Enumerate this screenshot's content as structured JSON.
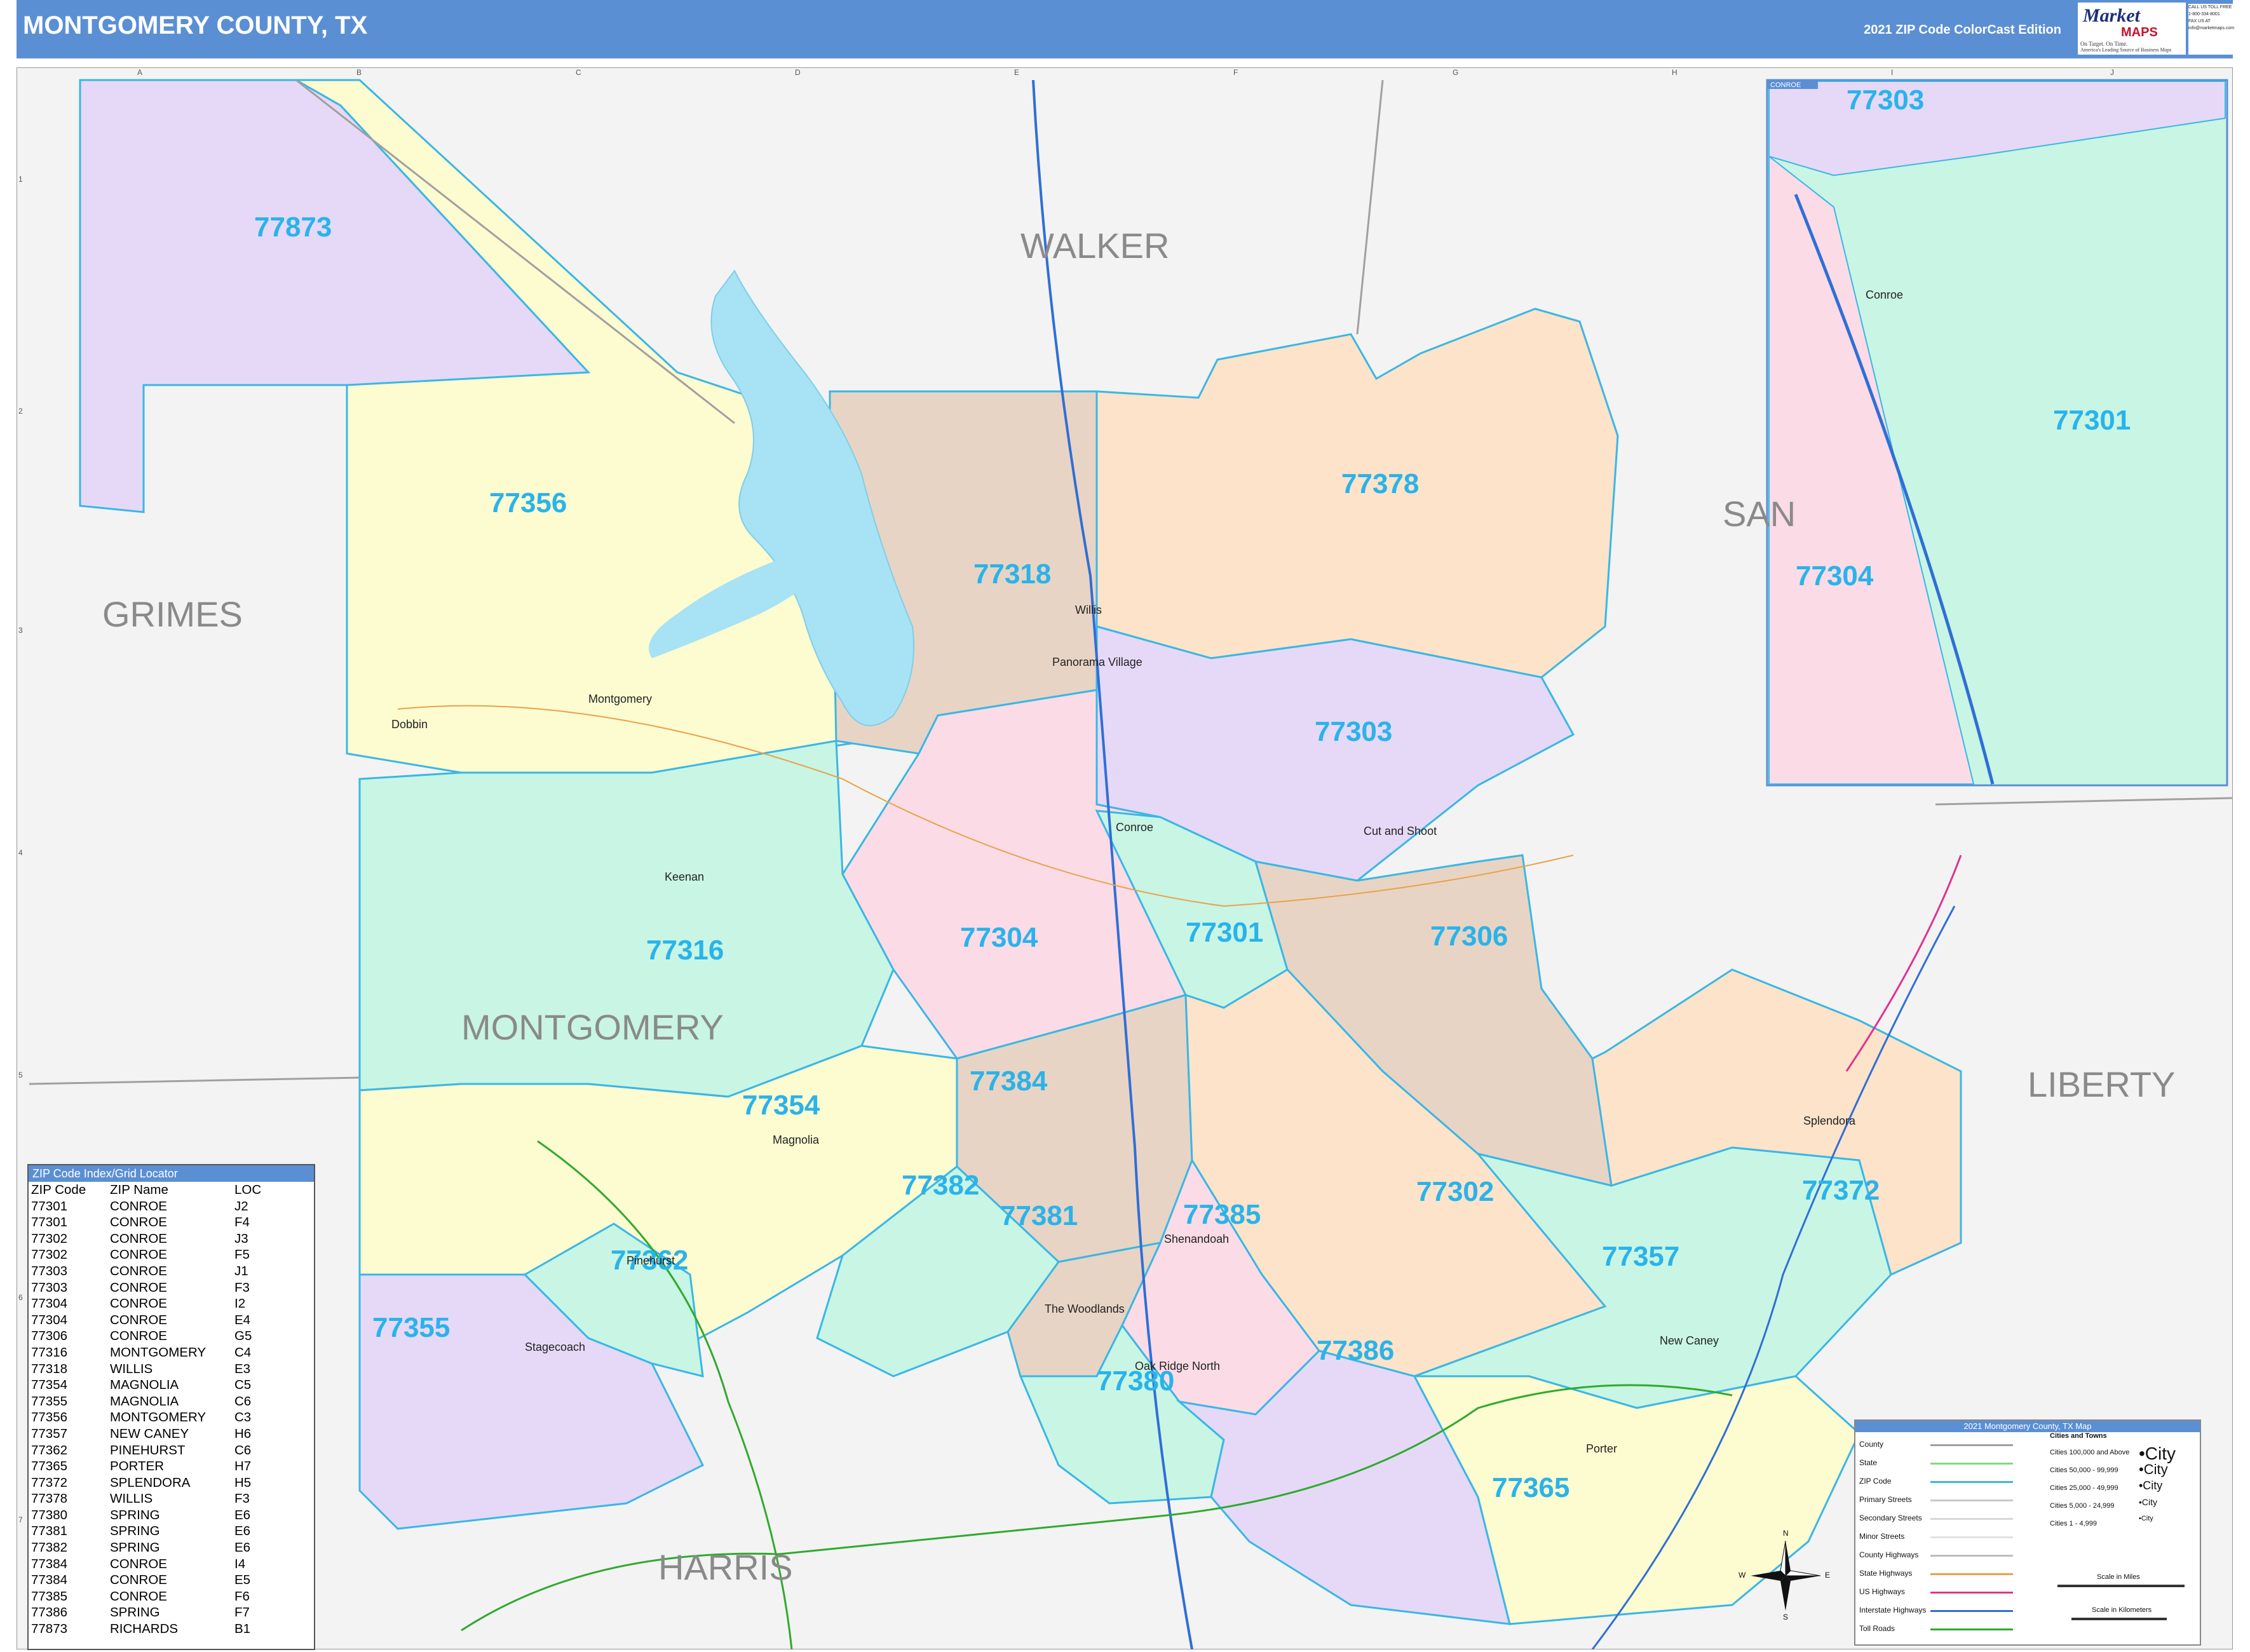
{
  "header": {
    "title": "MONTGOMERY COUNTY, TX",
    "edition": "2021 ZIP Code ColorCast Edition"
  },
  "logo": {
    "brand_top": "Market",
    "brand_bottom": "MAPS",
    "tagline1": "On Target. On Time.",
    "tagline2": "America's Leading Source of Business Maps",
    "side_lines": [
      "CALL US TOLL FREE",
      "1-800-334-8001",
      "FAX US AT",
      "info@marketmaps.com"
    ]
  },
  "counties": {
    "walker": "WALKER",
    "grimes": "GRIMES",
    "montgomery": "MONTGOMERY",
    "san_jacinto": "SAN",
    "liberty": "LIBERTY",
    "harris": "HARRIS"
  },
  "zip_labels": {
    "z77873": "77873",
    "z77356": "77356",
    "z77318": "77318",
    "z77378": "77378",
    "z77303": "77303",
    "z77316": "77316",
    "z77304": "77304",
    "z77301": "77301",
    "z77306": "77306",
    "z77384": "77384",
    "z77354": "77354",
    "z77382": "77382",
    "z77381": "77381",
    "z77385": "77385",
    "z77302": "77302",
    "z77372": "77372",
    "z77362": "77362",
    "z77357": "77357",
    "z77355": "77355",
    "z77386": "77386",
    "z77380": "77380",
    "z77365": "77365"
  },
  "inset": {
    "title": "CONROE",
    "city": "Conroe",
    "z77303": "77303",
    "z77301": "77301",
    "z77304": "77304"
  },
  "cities": {
    "woodlands": "The Woodlands",
    "montgomery": "Montgomery",
    "willis": "Willis",
    "conroe": "Conroe",
    "magnolia": "Magnolia",
    "splendora": "Splendora",
    "porter": "Porter",
    "new_caney": "New Caney",
    "shenandoah": "Shenandoah",
    "oak_ridge": "Oak Ridge North",
    "panorama": "Panorama Village",
    "cut_shoot": "Cut and Shoot",
    "pinehurst": "Pinehurst",
    "stagecoach": "Stagecoach",
    "keenan": "Keenan",
    "dobbin": "Dobbin"
  },
  "grid": {
    "columns": [
      "A",
      "B",
      "C",
      "D",
      "E",
      "F",
      "G",
      "H",
      "I",
      "J"
    ],
    "rows": [
      "1",
      "2",
      "3",
      "4",
      "5",
      "6",
      "7"
    ]
  },
  "index": {
    "title": "ZIP Code Index/Grid Locator",
    "headers": [
      "ZIP Code",
      "ZIP Name",
      "LOC"
    ],
    "rows": [
      [
        "77301",
        "CONROE",
        "J2"
      ],
      [
        "77301",
        "CONROE",
        "F4"
      ],
      [
        "77302",
        "CONROE",
        "J3"
      ],
      [
        "77302",
        "CONROE",
        "F5"
      ],
      [
        "77303",
        "CONROE",
        "J1"
      ],
      [
        "77303",
        "CONROE",
        "F3"
      ],
      [
        "77304",
        "CONROE",
        "I2"
      ],
      [
        "77304",
        "CONROE",
        "E4"
      ],
      [
        "77306",
        "CONROE",
        "G5"
      ],
      [
        "77316",
        "MONTGOMERY",
        "C4"
      ],
      [
        "77318",
        "WILLIS",
        "E3"
      ],
      [
        "77354",
        "MAGNOLIA",
        "C5"
      ],
      [
        "77355",
        "MAGNOLIA",
        "C6"
      ],
      [
        "77356",
        "MONTGOMERY",
        "C3"
      ],
      [
        "77357",
        "NEW CANEY",
        "H6"
      ],
      [
        "77362",
        "PINEHURST",
        "C6"
      ],
      [
        "77365",
        "PORTER",
        "H7"
      ],
      [
        "77372",
        "SPLENDORA",
        "H5"
      ],
      [
        "77378",
        "WILLIS",
        "F3"
      ],
      [
        "77380",
        "SPRING",
        "E6"
      ],
      [
        "77381",
        "SPRING",
        "E6"
      ],
      [
        "77382",
        "SPRING",
        "E6"
      ],
      [
        "77384",
        "CONROE",
        "I4"
      ],
      [
        "77384",
        "CONROE",
        "E5"
      ],
      [
        "77385",
        "CONROE",
        "F6"
      ],
      [
        "77386",
        "SPRING",
        "F7"
      ],
      [
        "77873",
        "RICHARDS",
        "B1"
      ]
    ]
  },
  "legend": {
    "title": "2021 Montgomery County, TX Map",
    "items": [
      {
        "label": "County",
        "color": "#a0a0a0"
      },
      {
        "label": "State",
        "color": "#7ddc7d"
      },
      {
        "label": "ZIP Code",
        "color": "#39b7e6"
      },
      {
        "label": "Primary Streets",
        "color": "#c9c9c9"
      },
      {
        "label": "Secondary Streets",
        "color": "#d8d8d8"
      },
      {
        "label": "Minor Streets",
        "color": "#e2e2e2"
      },
      {
        "label": "County Highways",
        "color": "#bdbdbd"
      },
      {
        "label": "State Highways",
        "color": "#e8a24a"
      },
      {
        "label": "US Highways",
        "color": "#e0338f"
      },
      {
        "label": "Interstate Highways",
        "color": "#2f6fd6"
      },
      {
        "label": "Toll Roads",
        "color": "#2faa2f"
      }
    ],
    "cities_title": "Cities and Towns",
    "city_classes": [
      {
        "label": "Cities 100,000 and Above",
        "sample": "•City"
      },
      {
        "label": "Cities 50,000 - 99,999",
        "sample": "•City"
      },
      {
        "label": "Cities 25,000 - 49,999",
        "sample": "•City"
      },
      {
        "label": "Cities 5,000 - 24,999",
        "sample": "•City"
      },
      {
        "label": "Cities 1 - 4,999",
        "sample": "•City"
      }
    ],
    "scale_miles": "Scale in Miles",
    "scale_km": "Scale in Kilometers",
    "compass": {
      "n": "N",
      "s": "S",
      "e": "E",
      "w": "W"
    }
  },
  "colors": {
    "header": "#5b8fd4",
    "zip_label": "#2ab3ea",
    "lavender": "#e6d9f7",
    "yellow": "#fdfbd0",
    "mint": "#c9f5e4",
    "tan": "#e8d4c4",
    "peach": "#fde3c9",
    "pink": "#fbdbe6",
    "water": "#a8e2f5"
  }
}
